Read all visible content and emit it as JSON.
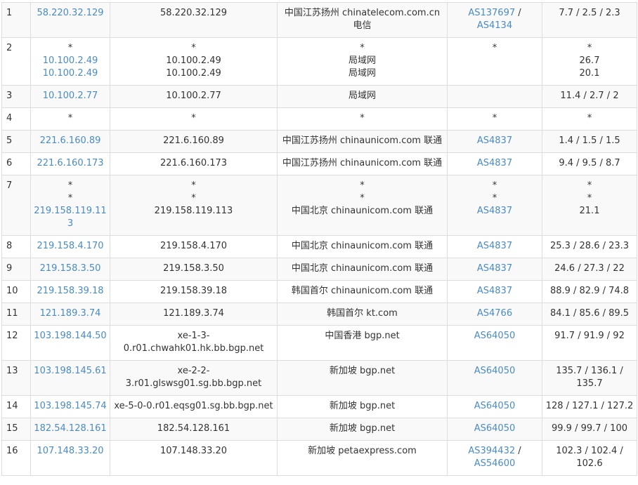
{
  "colors": {
    "link": "#4a8bc2",
    "text": "#333333",
    "border": "#dddddd",
    "stripe": "#f9f9f9"
  },
  "rows": [
    {
      "hop": "1",
      "ip": [
        "58.220.32.129"
      ],
      "host": [
        "58.220.32.129"
      ],
      "geo": [
        "中国江苏扬州 chinatelecom.com.cn 电信"
      ],
      "asn": [
        [
          "AS137697",
          "AS4134"
        ]
      ],
      "rtt": [
        "7.7 / 2.5 / 2.3"
      ]
    },
    {
      "hop": "2",
      "ip": [
        "*",
        "10.100.2.49",
        "10.100.2.49"
      ],
      "host": [
        "*",
        "10.100.2.49",
        "10.100.2.49"
      ],
      "geo": [
        "*",
        "局域网",
        "局域网"
      ],
      "asn": [
        [
          "*"
        ]
      ],
      "rtt": [
        "*",
        "26.7",
        "20.1"
      ]
    },
    {
      "hop": "3",
      "ip": [
        "10.100.2.77"
      ],
      "host": [
        "10.100.2.77"
      ],
      "geo": [
        "局域网"
      ],
      "asn": [],
      "rtt": [
        "11.4 / 2.7 / 2"
      ]
    },
    {
      "hop": "4",
      "ip": [
        "*"
      ],
      "host": [
        "*"
      ],
      "geo": [
        "*"
      ],
      "asn": [
        [
          "*"
        ]
      ],
      "rtt": [
        "*"
      ]
    },
    {
      "hop": "5",
      "ip": [
        "221.6.160.89"
      ],
      "host": [
        "221.6.160.89"
      ],
      "geo": [
        "中国江苏扬州 chinaunicom.com 联通"
      ],
      "asn": [
        [
          "AS4837"
        ]
      ],
      "rtt": [
        "1.4 / 1.5 / 1.5"
      ]
    },
    {
      "hop": "6",
      "ip": [
        "221.6.160.173"
      ],
      "host": [
        "221.6.160.173"
      ],
      "geo": [
        "中国江苏扬州 chinaunicom.com 联通"
      ],
      "asn": [
        [
          "AS4837"
        ]
      ],
      "rtt": [
        "9.4 / 9.5 / 8.7"
      ]
    },
    {
      "hop": "7",
      "ip": [
        "*",
        "*",
        "219.158.119.113"
      ],
      "host": [
        "*",
        "*",
        "219.158.119.113"
      ],
      "geo": [
        "*",
        "*",
        "中国北京 chinaunicom.com 联通"
      ],
      "asn": [
        [
          "*"
        ],
        [
          "*"
        ],
        [
          "AS4837"
        ]
      ],
      "rtt": [
        "*",
        "*",
        "21.1"
      ]
    },
    {
      "hop": "8",
      "ip": [
        "219.158.4.170"
      ],
      "host": [
        "219.158.4.170"
      ],
      "geo": [
        "中国北京 chinaunicom.com 联通"
      ],
      "asn": [
        [
          "AS4837"
        ]
      ],
      "rtt": [
        "25.3 / 28.6 / 23.3"
      ]
    },
    {
      "hop": "9",
      "ip": [
        "219.158.3.50"
      ],
      "host": [
        "219.158.3.50"
      ],
      "geo": [
        "中国北京 chinaunicom.com 联通"
      ],
      "asn": [
        [
          "AS4837"
        ]
      ],
      "rtt": [
        "24.6 / 27.3 / 22"
      ]
    },
    {
      "hop": "10",
      "ip": [
        "219.158.39.18"
      ],
      "host": [
        "219.158.39.18"
      ],
      "geo": [
        "韩国首尔 chinaunicom.com 联通"
      ],
      "asn": [
        [
          "AS4837"
        ]
      ],
      "rtt": [
        "88.9 / 82.9 / 74.8"
      ]
    },
    {
      "hop": "11",
      "ip": [
        "121.189.3.74"
      ],
      "host": [
        "121.189.3.74"
      ],
      "geo": [
        "韩国首尔 kt.com"
      ],
      "asn": [
        [
          "AS4766"
        ]
      ],
      "rtt": [
        "84.1 / 85.6 / 89.5"
      ]
    },
    {
      "hop": "12",
      "ip": [
        "103.198.144.50"
      ],
      "host": [
        "xe-1-3-0.r01.chwahk01.hk.bb.bgp.net"
      ],
      "geo": [
        "中国香港 bgp.net"
      ],
      "asn": [
        [
          "AS64050"
        ]
      ],
      "rtt": [
        "91.7 / 91.9 / 92"
      ]
    },
    {
      "hop": "13",
      "ip": [
        "103.198.145.61"
      ],
      "host": [
        "xe-2-2-3.r01.glswsg01.sg.bb.bgp.net"
      ],
      "geo": [
        "新加坡 bgp.net"
      ],
      "asn": [
        [
          "AS64050"
        ]
      ],
      "rtt": [
        "135.7 / 136.1 / 135.7"
      ]
    },
    {
      "hop": "14",
      "ip": [
        "103.198.145.74"
      ],
      "host": [
        "xe-5-0-0.r01.eqsg01.sg.bb.bgp.net"
      ],
      "geo": [
        "新加坡 bgp.net"
      ],
      "asn": [
        [
          "AS64050"
        ]
      ],
      "rtt": [
        "128 / 127.1 / 127.2"
      ]
    },
    {
      "hop": "15",
      "ip": [
        "182.54.128.161"
      ],
      "host": [
        "182.54.128.161"
      ],
      "geo": [
        "新加坡 bgp.net"
      ],
      "asn": [
        [
          "AS64050"
        ]
      ],
      "rtt": [
        "99.9 / 99.7 / 100"
      ]
    },
    {
      "hop": "16",
      "ip": [
        "107.148.33.20"
      ],
      "host": [
        "107.148.33.20"
      ],
      "geo": [
        "新加坡 petaexpress.com"
      ],
      "asn": [
        [
          "AS394432",
          "AS54600"
        ]
      ],
      "rtt": [
        "102.3 / 102.4 / 102.6"
      ]
    }
  ]
}
